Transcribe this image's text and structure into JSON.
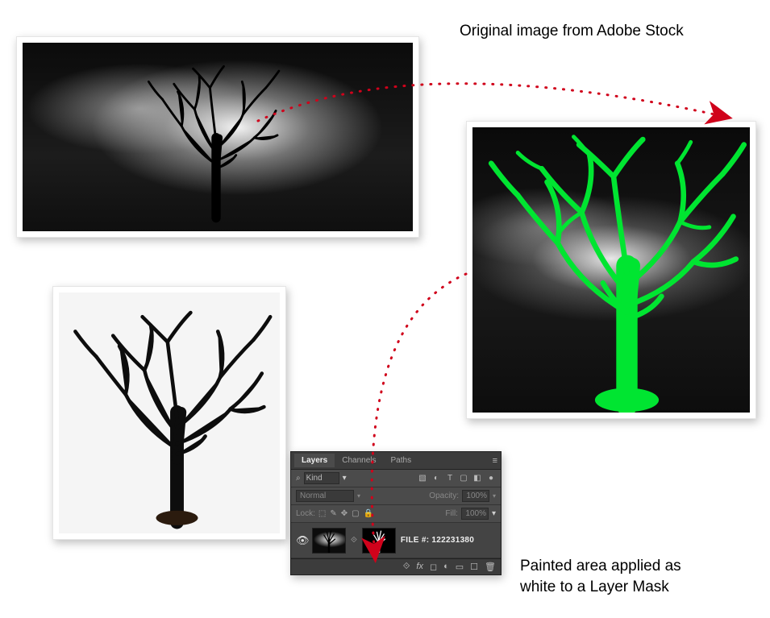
{
  "captions": {
    "top": "Original image from Adobe Stock",
    "bottom_line1": "Painted area applied as",
    "bottom_line2": "white to a Layer Mask"
  },
  "layers_panel": {
    "tabs": {
      "layers": "Layers",
      "channels": "Channels",
      "paths": "Paths"
    },
    "kind_label": "Kind",
    "kind_value": "Kind",
    "blend_mode": "Normal",
    "opacity_label": "Opacity:",
    "opacity_value": "100%",
    "lock_label": "Lock:",
    "fill_label": "Fill:",
    "fill_value": "100%",
    "layer_name": "FILE #:  122231380"
  },
  "icons": {
    "search": "⌕",
    "hamburger": "≡",
    "eye": "👁",
    "link": "⟐",
    "fx": "fx",
    "mask_sq": "◻",
    "adjust": "◐",
    "folder": "▭",
    "new": "☐",
    "trash": "🗑",
    "img_ic": "▧",
    "adj_ic": "◐",
    "tx_ic": "T",
    "shape_ic": "▢",
    "smart_ic": "◧",
    "circ_ic": "●",
    "lock_ic": "🔒",
    "brush_ic": "✎",
    "move_ic": "✥",
    "pix_ic": "⬚",
    "chev": "▾"
  }
}
